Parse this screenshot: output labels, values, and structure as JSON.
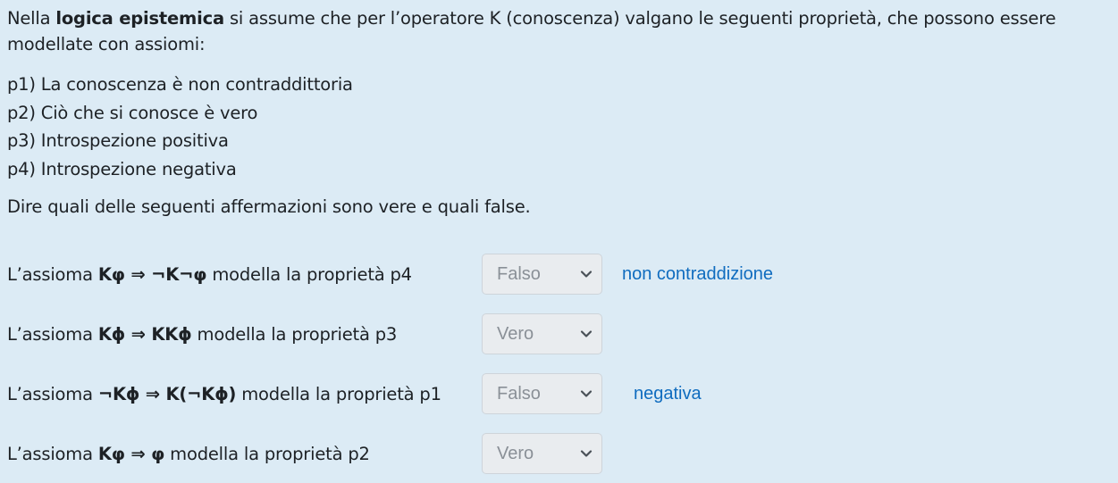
{
  "intro": {
    "before_bold": "Nella ",
    "bold": "logica epistemica",
    "after_bold": " si assume che per l’operatore K (conoscenza) valgano le seguenti proprietà, che possono essere modellate con assiomi:"
  },
  "properties": [
    "p1) La conoscenza è non contraddittoria",
    "p2) Ciò che si conosce è vero",
    "p3) Introspezione positiva",
    "p4) Introspezione negativa"
  ],
  "instruction": "Dire quali delle seguenti affermazioni sono vere e quali false.",
  "questions": [
    {
      "prefix": "L’assioma ",
      "formula": "Kφ ⇒ ¬K¬φ",
      "suffix": " modella la proprietà p4",
      "selected": "Falso",
      "feedback": "non contraddizione"
    },
    {
      "prefix": "L’assioma ",
      "formula": "Kϕ ⇒ KKϕ",
      "suffix": " modella la proprietà p3",
      "selected": "Vero",
      "feedback": ""
    },
    {
      "prefix": "L’assioma ",
      "formula": "¬Kϕ ⇒ K(¬Kϕ)",
      "suffix": " modella la proprietà p1",
      "selected": "Falso",
      "feedback": "negativa"
    },
    {
      "prefix": "L’assioma ",
      "formula": "Kφ ⇒ φ",
      "suffix": " modella la proprietà p2",
      "selected": "Vero",
      "feedback": ""
    }
  ],
  "icons": {
    "select_arrow": "chevron-down-icon"
  },
  "colors": {
    "background": "#dcebf5",
    "select_background": "#e9ecef",
    "select_text": "#8a9097",
    "feedback": "#0f6cbf"
  }
}
